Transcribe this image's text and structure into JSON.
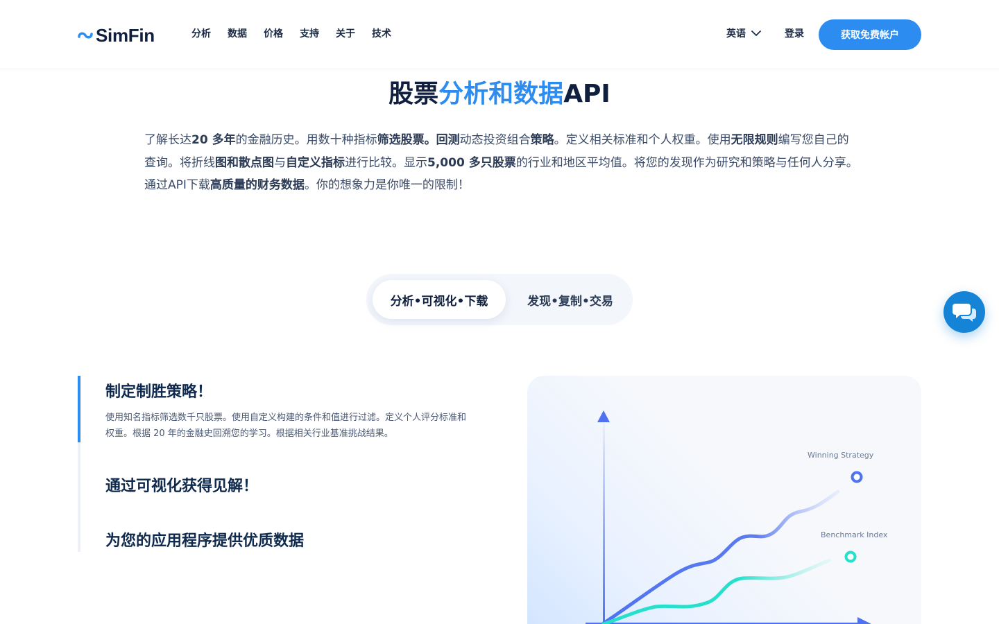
{
  "header": {
    "logo_text": "SimFin",
    "nav": [
      "分析",
      "数据",
      "价格",
      "支持",
      "关于",
      "技术"
    ],
    "language": "英语",
    "login": "登录",
    "cta": "获取免费帐户"
  },
  "hero": {
    "title_part1": "股票",
    "title_accent": "分析和数据",
    "title_part2": "API",
    "paragraph": [
      {
        "t": "了解长达",
        "b": false
      },
      {
        "t": "20 多年",
        "b": true
      },
      {
        "t": "的金融历史。用数十种指标",
        "b": false
      },
      {
        "t": "筛选股票。回测",
        "b": true
      },
      {
        "t": "动态投资组合",
        "b": false
      },
      {
        "t": "策略",
        "b": true
      },
      {
        "t": "。定义相关标准和个人权重。使用",
        "b": false
      },
      {
        "t": "无限规则",
        "b": true
      },
      {
        "t": "编写您自己的查询。将折线",
        "b": false
      },
      {
        "t": "图和散点图",
        "b": true
      },
      {
        "t": "与",
        "b": false
      },
      {
        "t": "自定义指标",
        "b": true
      },
      {
        "t": "进行比较。显示",
        "b": false
      },
      {
        "t": "5,000 多只股票",
        "b": true
      },
      {
        "t": "的行业和地区平均值。将您的发现作为研究和策略与任何人分享。通过API下载",
        "b": false
      },
      {
        "t": "高质量的财务数据",
        "b": true
      },
      {
        "t": "。你的想象力是你唯一的限制！",
        "b": false
      }
    ]
  },
  "toggle": {
    "active": "分析•可视化•下载",
    "inactive": "发现•复制•交易"
  },
  "features": {
    "items": [
      {
        "title": "制定制胜策略！",
        "desc": "使用知名指标筛选数千只股票。使用自定义构建的条件和值进行过滤。定义个人评分标准和权重。根据 20 年的金融史回溯您的学习。根据相关行业基准挑战结果。",
        "active": true
      },
      {
        "title": "通过可视化获得见解！",
        "desc": "",
        "active": false
      },
      {
        "title": "为您的应用程序提供优质数据",
        "desc": "",
        "active": false
      }
    ]
  },
  "chart": {
    "series": [
      {
        "label": "Winning Strategy",
        "color": "#4f73f0",
        "point_color": "#4f73f0"
      },
      {
        "label": "Benchmark Index",
        "color": "#27e0cc",
        "point_color": "#27e0cc"
      }
    ]
  },
  "icons": {
    "logo": "simfin-logo-icon",
    "language_chevron": "chevron-down-icon",
    "chat": "chat-bubbles-icon"
  },
  "colors": {
    "accent": "#2d8cf0",
    "title": "#0f1f3d",
    "chat": "#1583d6"
  }
}
